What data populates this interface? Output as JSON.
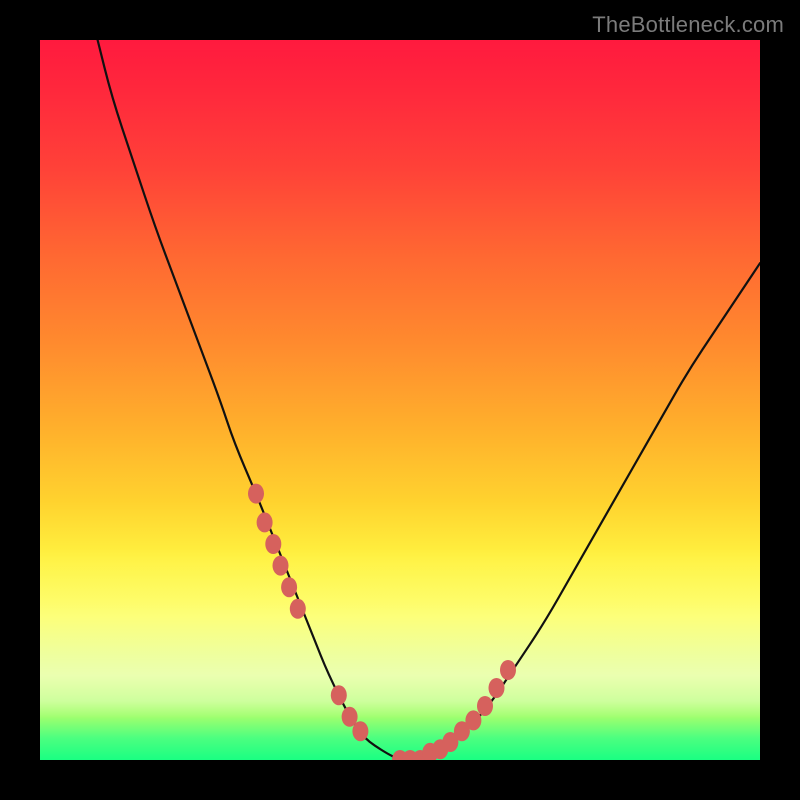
{
  "watermark": "TheBottleneck.com",
  "colors": {
    "gradient_top": "#ff1a3e",
    "gradient_bottom": "#1aff82",
    "marker": "#d6615d",
    "curve": "#111111",
    "frame": "#000000"
  },
  "chart_data": {
    "type": "line",
    "title": "",
    "xlabel": "",
    "ylabel": "",
    "xlim": [
      0,
      100
    ],
    "ylim": [
      0,
      100
    ],
    "grid": false,
    "legend": false,
    "series": [
      {
        "name": "bottleneck-curve",
        "x": [
          8,
          10,
          13,
          16,
          19,
          22,
          25,
          27,
          30,
          32,
          34,
          36,
          38,
          40,
          43,
          45,
          48,
          50,
          52,
          55,
          58,
          62,
          66,
          70,
          74,
          78,
          82,
          86,
          90,
          94,
          98,
          100
        ],
        "y": [
          100,
          92,
          83,
          74,
          66,
          58,
          50,
          44,
          37,
          32,
          27,
          22,
          17,
          12,
          6,
          3,
          1,
          0,
          0,
          1,
          3,
          7,
          13,
          19,
          26,
          33,
          40,
          47,
          54,
          60,
          66,
          69
        ]
      }
    ],
    "markers": {
      "name": "highlight-points",
      "x": [
        30.0,
        31.2,
        32.4,
        33.4,
        34.6,
        35.8,
        41.5,
        43.0,
        44.5,
        50.0,
        51.4,
        52.8,
        54.2,
        55.6,
        57.0,
        58.6,
        60.2,
        61.8,
        63.4,
        65.0
      ],
      "y": [
        37,
        33,
        30,
        27,
        24,
        21,
        9,
        6,
        4,
        0,
        0,
        0,
        1,
        1.5,
        2.5,
        4,
        5.5,
        7.5,
        10,
        12.5
      ]
    }
  }
}
